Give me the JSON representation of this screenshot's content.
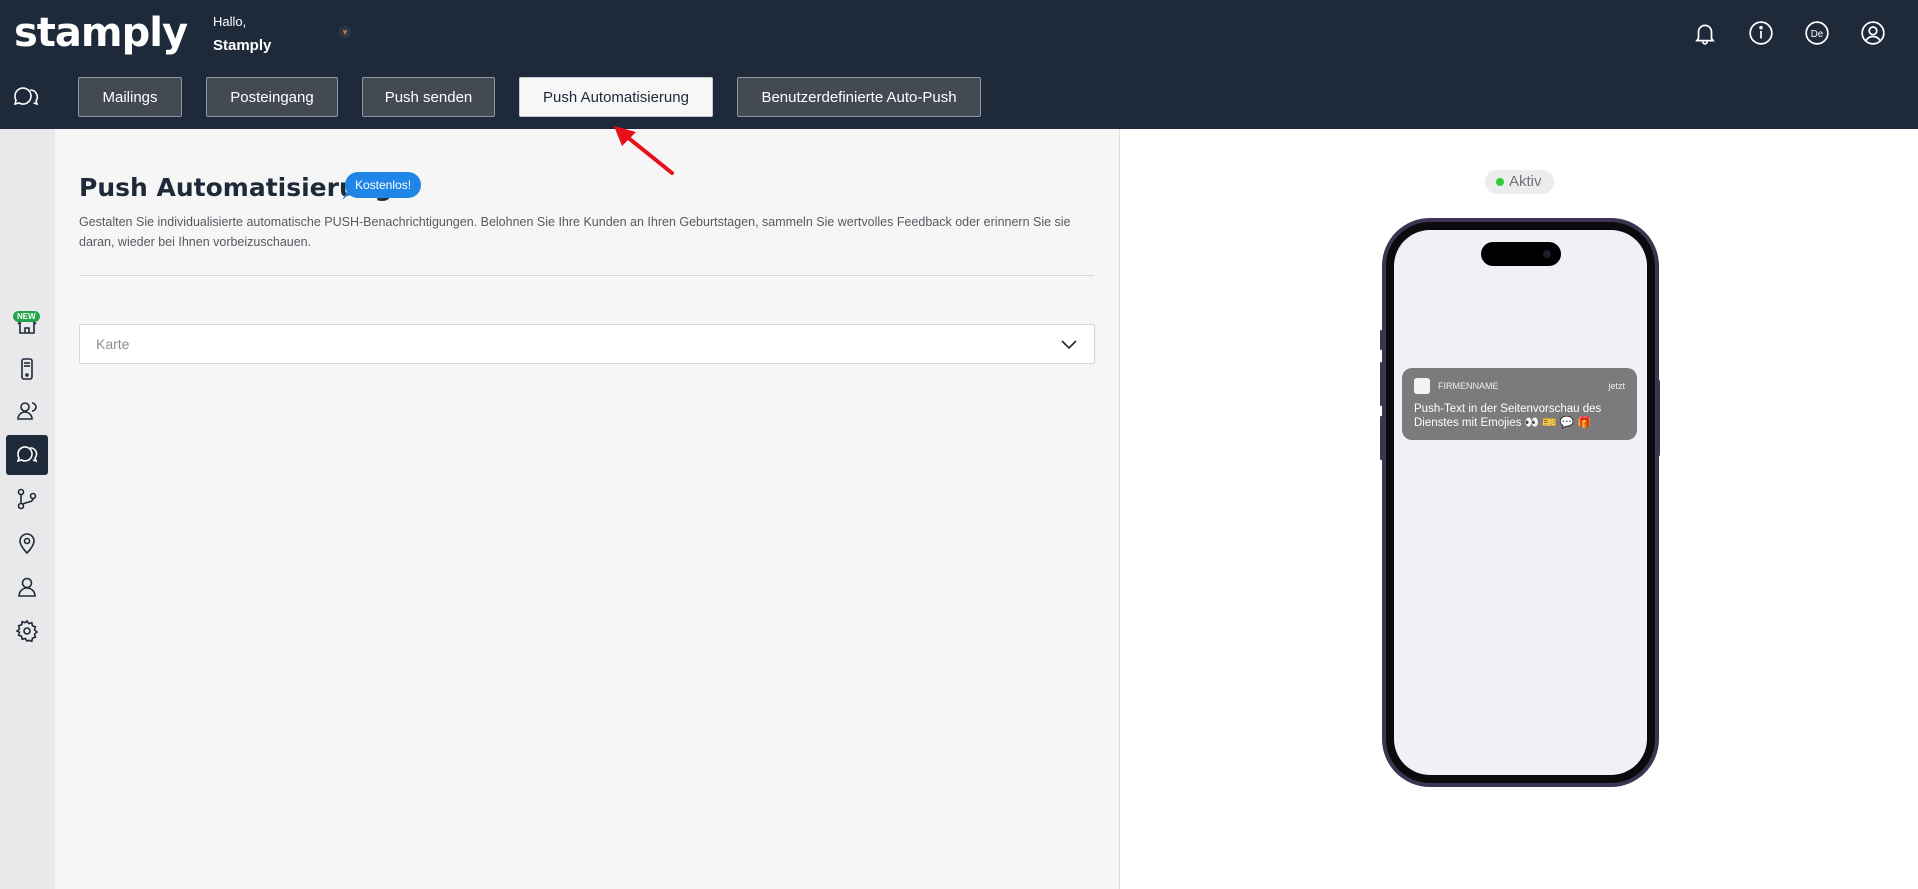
{
  "brand": {
    "logo_text": "stamply"
  },
  "greeting": {
    "hello": "Hallo,",
    "name": "Stamply"
  },
  "top_icons": {
    "notifications": "bell-icon",
    "info": "info-icon",
    "language_label": "De",
    "account": "user-circle-icon"
  },
  "tabs": [
    {
      "label": "Mailings",
      "active": false
    },
    {
      "label": "Posteingang",
      "active": false
    },
    {
      "label": "Push senden",
      "active": false
    },
    {
      "label": "Push Automatisierung",
      "active": true
    },
    {
      "label": "Benutzerdefinierte Auto-Push",
      "active": false
    }
  ],
  "sidebar": {
    "items": [
      {
        "name": "home",
        "icon": "home-icon"
      },
      {
        "name": "mobile-app",
        "icon": "phone-icon",
        "badge": "NEW"
      },
      {
        "name": "customers",
        "icon": "users-icon"
      },
      {
        "name": "messages",
        "icon": "chat-icon",
        "active": true
      },
      {
        "name": "automation",
        "icon": "flow-icon"
      },
      {
        "name": "locations",
        "icon": "map-pin-icon"
      },
      {
        "name": "staff",
        "icon": "user-icon"
      },
      {
        "name": "settings",
        "icon": "gear-icon"
      }
    ]
  },
  "main": {
    "title": "Push Automatisierung",
    "badge": "Kostenlos!",
    "description": "Gestalten Sie individualisierte automatische PUSH-Benachrichtigungen. Belohnen Sie Ihre Kunden an Ihren Geburtstagen, sammeln Sie wertvolles Feedback oder erinnern Sie sie daran, wieder bei Ihnen vorbeizuschauen.",
    "card_select": {
      "placeholder": "Karte"
    }
  },
  "preview": {
    "status": "Aktiv",
    "status_color": "#2ccf3b",
    "notification": {
      "app_name": "FIRMENNAME",
      "time": "jetzt",
      "message": "Push-Text in der Seitenvorschau des Dienstes mit Emojies 👀 🎫 💬 🎁"
    }
  },
  "colors": {
    "header_bg": "#1e2a3a",
    "accent_blue": "#1f86e8",
    "annotation_arrow": "#e8101a"
  }
}
